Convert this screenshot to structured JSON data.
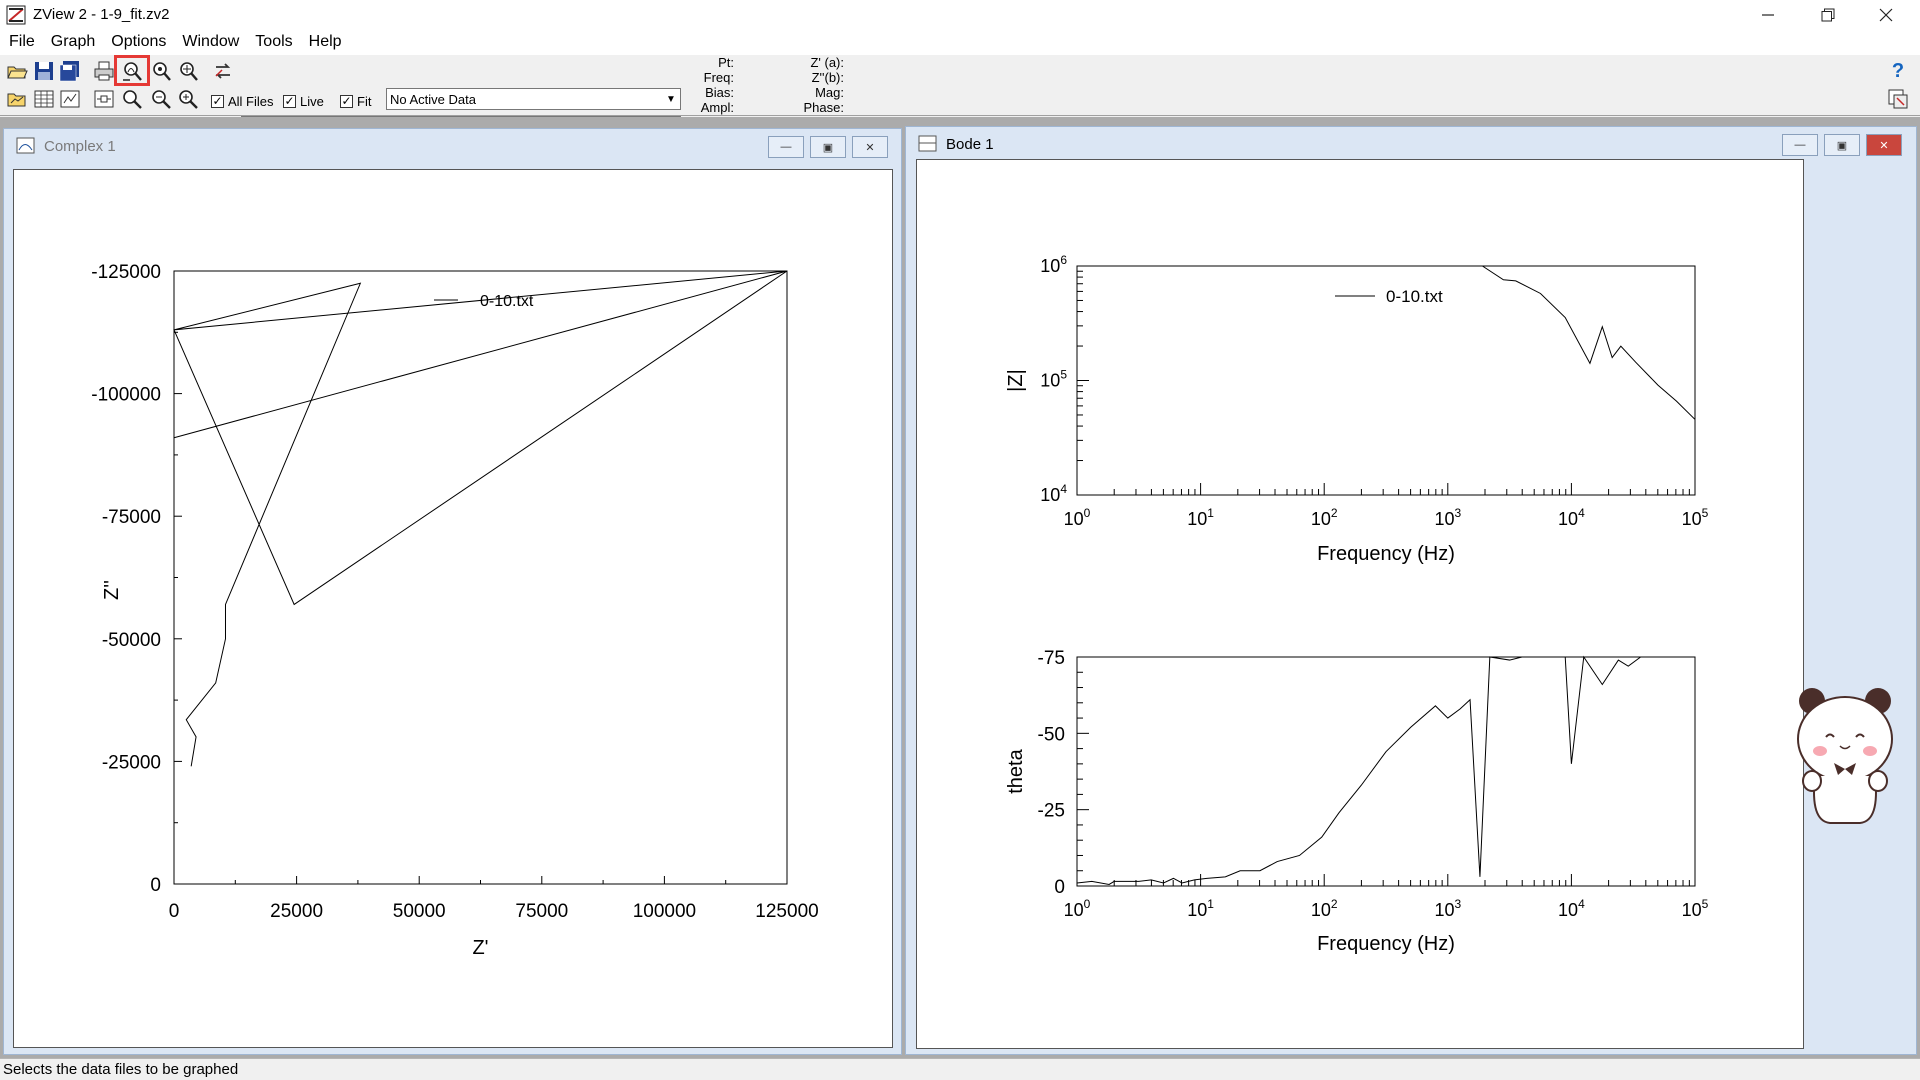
{
  "window": {
    "title": "ZView 2 - 1-9_fit.zv2"
  },
  "menu": [
    "File",
    "Graph",
    "Options",
    "Window",
    "Tools",
    "Help"
  ],
  "toolbar": {
    "checks": {
      "all_files": "All Files",
      "live": "Live",
      "fit": "Fit"
    },
    "active_data": "No Active Data",
    "readouts_left": {
      "pt": "Pt:",
      "freq": "Freq:",
      "bias": "Bias:",
      "ampl": "Ampl:"
    },
    "readouts_right": {
      "za": "Z' (a):",
      "zb": "Z''(b):",
      "mag": "Mag:",
      "phase": "Phase:"
    },
    "highlighted_button": "select-data-files-button"
  },
  "complex_window": {
    "title": "Complex 1",
    "chart_data": {
      "type": "line",
      "legend": "0-10.txt",
      "xlabel": "Z'",
      "ylabel": "Z''",
      "x_ticks": [
        "0",
        "25000",
        "50000",
        "75000",
        "100000",
        "125000"
      ],
      "y_ticks": [
        "-125000",
        "-100000",
        "-75000",
        "-50000",
        "-25000",
        "0"
      ],
      "xlim": [
        0,
        125000
      ],
      "ylim": [
        0,
        -125000
      ],
      "series": [
        {
          "points": [
            [
              3500,
              -24000
            ],
            [
              4500,
              -30000
            ],
            [
              2500,
              -33500
            ],
            [
              8500,
              -41000
            ],
            [
              10500,
              -50000
            ],
            [
              10500,
              -57000
            ],
            [
              38000,
              -122500
            ],
            [
              0,
              -113000
            ],
            [
              125000,
              -125000
            ],
            [
              0,
              -91000
            ],
            [
              125000,
              -125000
            ],
            [
              24500,
              -57000
            ],
            [
              0,
              -113000
            ],
            [
              125000,
              -125000
            ]
          ]
        }
      ]
    }
  },
  "bode_window": {
    "title": "Bode 1",
    "magnitude_chart": {
      "type": "line",
      "legend": "0-10.txt",
      "xlabel": "Frequency (Hz)",
      "ylabel": "|Z|",
      "x_ticks": [
        "10^0",
        "10^1",
        "10^2",
        "10^3",
        "10^4",
        "10^5"
      ],
      "y_ticks": [
        "10^4",
        "10^5",
        "10^6"
      ],
      "xlim_log10": [
        0,
        5
      ],
      "ylim_log10": [
        4,
        6
      ],
      "points": [
        [
          3.28,
          6.0
        ],
        [
          3.45,
          5.88
        ],
        [
          3.55,
          5.87
        ],
        [
          3.75,
          5.76
        ],
        [
          3.95,
          5.55
        ],
        [
          4.15,
          5.15
        ],
        [
          4.25,
          5.47
        ],
        [
          4.33,
          5.2
        ],
        [
          4.4,
          5.3
        ],
        [
          4.52,
          5.16
        ],
        [
          4.7,
          4.96
        ],
        [
          4.85,
          4.82
        ],
        [
          5.0,
          4.66
        ]
      ]
    },
    "phase_chart": {
      "type": "line",
      "xlabel": "Frequency (Hz)",
      "ylabel": "theta",
      "x_ticks": [
        "10^0",
        "10^1",
        "10^2",
        "10^3",
        "10^4",
        "10^5"
      ],
      "y_ticks": [
        "-75",
        "-50",
        "-25",
        "0"
      ],
      "xlim_log10": [
        0,
        5
      ],
      "ylim": [
        0,
        -75
      ],
      "points": [
        [
          0.0,
          -1
        ],
        [
          0.12,
          -1.5
        ],
        [
          0.26,
          -0.5
        ],
        [
          0.3,
          -1.5
        ],
        [
          0.5,
          -1.5
        ],
        [
          0.6,
          -2
        ],
        [
          0.7,
          -1
        ],
        [
          0.78,
          -2.5
        ],
        [
          0.85,
          -1
        ],
        [
          0.95,
          -2
        ],
        [
          1.05,
          -2.5
        ],
        [
          1.2,
          -3
        ],
        [
          1.32,
          -5
        ],
        [
          1.48,
          -5
        ],
        [
          1.62,
          -8
        ],
        [
          1.8,
          -10
        ],
        [
          1.98,
          -16
        ],
        [
          2.12,
          -24
        ],
        [
          2.3,
          -33
        ],
        [
          2.5,
          -44
        ],
        [
          2.7,
          -52
        ],
        [
          2.9,
          -59
        ],
        [
          3.0,
          -55
        ],
        [
          3.1,
          -58
        ],
        [
          3.18,
          -61
        ],
        [
          3.26,
          -3
        ],
        [
          3.34,
          -75
        ],
        [
          3.5,
          -74
        ],
        [
          3.6,
          -75
        ],
        [
          3.95,
          -75
        ],
        [
          4.0,
          -40
        ],
        [
          4.1,
          -75
        ],
        [
          4.25,
          -66
        ],
        [
          4.38,
          -74
        ],
        [
          4.46,
          -72
        ],
        [
          4.56,
          -75
        ]
      ]
    }
  },
  "status": {
    "text": "Selects the data files to be graphed"
  }
}
